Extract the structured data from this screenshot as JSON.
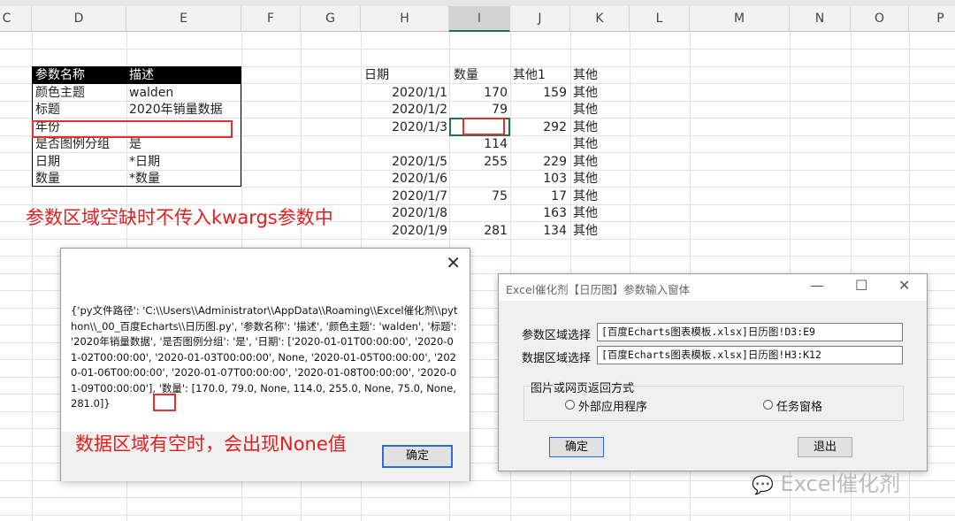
{
  "columns": [
    "C",
    "D",
    "E",
    "F",
    "G",
    "H",
    "I",
    "J",
    "K",
    "L",
    "M",
    "N",
    "O",
    "P"
  ],
  "selected_column": "I",
  "param_table": {
    "header": {
      "name": "参数名称",
      "desc": "描述"
    },
    "rows": [
      {
        "name": "颜色主题",
        "value": "walden"
      },
      {
        "name": "标题",
        "value": "2020年销量数据"
      },
      {
        "name": "年份",
        "value": ""
      },
      {
        "name": "是否图例分组",
        "value": "是"
      },
      {
        "name": "日期",
        "value": "*日期"
      },
      {
        "name": "数量",
        "value": "*数量"
      }
    ]
  },
  "data_table": {
    "headers": [
      "日期",
      "数量",
      "其他1",
      "其他"
    ],
    "rows": [
      [
        "2020/1/1",
        "170",
        "159",
        "其他"
      ],
      [
        "2020/1/2",
        "79",
        "",
        "其他"
      ],
      [
        "2020/1/3",
        "",
        "292",
        "其他"
      ],
      [
        "",
        "114",
        "",
        "其他"
      ],
      [
        "2020/1/5",
        "255",
        "229",
        "其他"
      ],
      [
        "2020/1/6",
        "",
        "103",
        "其他"
      ],
      [
        "2020/1/7",
        "75",
        "17",
        "其他"
      ],
      [
        "2020/1/8",
        "",
        "163",
        "其他"
      ],
      [
        "2020/1/9",
        "281",
        "134",
        "其他"
      ]
    ]
  },
  "annotations": {
    "missing_param_note": "参数区域空缺时不传入kwargs参数中",
    "none_note": "数据区域有空时，会出现None值"
  },
  "message_dialog": {
    "close_icon": "✕",
    "message": "{'py文件路径': 'C:\\\\Users\\\\Administrator\\\\AppData\\\\Roaming\\\\Excel催化剂\\\\python\\\\_00_百度Echarts\\\\日历图.py', '参数名称': '描述', '颜色主题': 'walden', '标题': '2020年销量数据', '是否图例分组': '是', '日期': ['2020-01-01T00:00:00', '2020-01-02T00:00:00', '2020-01-03T00:00:00', None, '2020-01-05T00:00:00', '2020-01-06T00:00:00', '2020-01-07T00:00:00', '2020-01-08T00:00:00', '2020-01-09T00:00:00'], '数量': [170.0, 79.0, None, 114.0, 255.0, None, 75.0, None, 281.0]}",
    "ok_label": "确定"
  },
  "input_dialog": {
    "title": "Excel催化剂【日历图】参数输入窗体",
    "param_label": "参数区域选择",
    "param_value": "[百度Echarts图表模板.xlsx]日历图!D3:E9",
    "data_label": "数据区域选择",
    "data_value": "[百度Echarts图表模板.xlsx]日历图!H3:K12",
    "group_label": "图片或网页返回方式",
    "option_external": "外部应用程序",
    "option_taskpane": "任务窗格",
    "ok_label": "确定",
    "exit_label": "退出",
    "minimize_glyph": "—",
    "maximize_glyph": "☐",
    "close_glyph": "✕"
  },
  "watermark": "Excel催化剂"
}
